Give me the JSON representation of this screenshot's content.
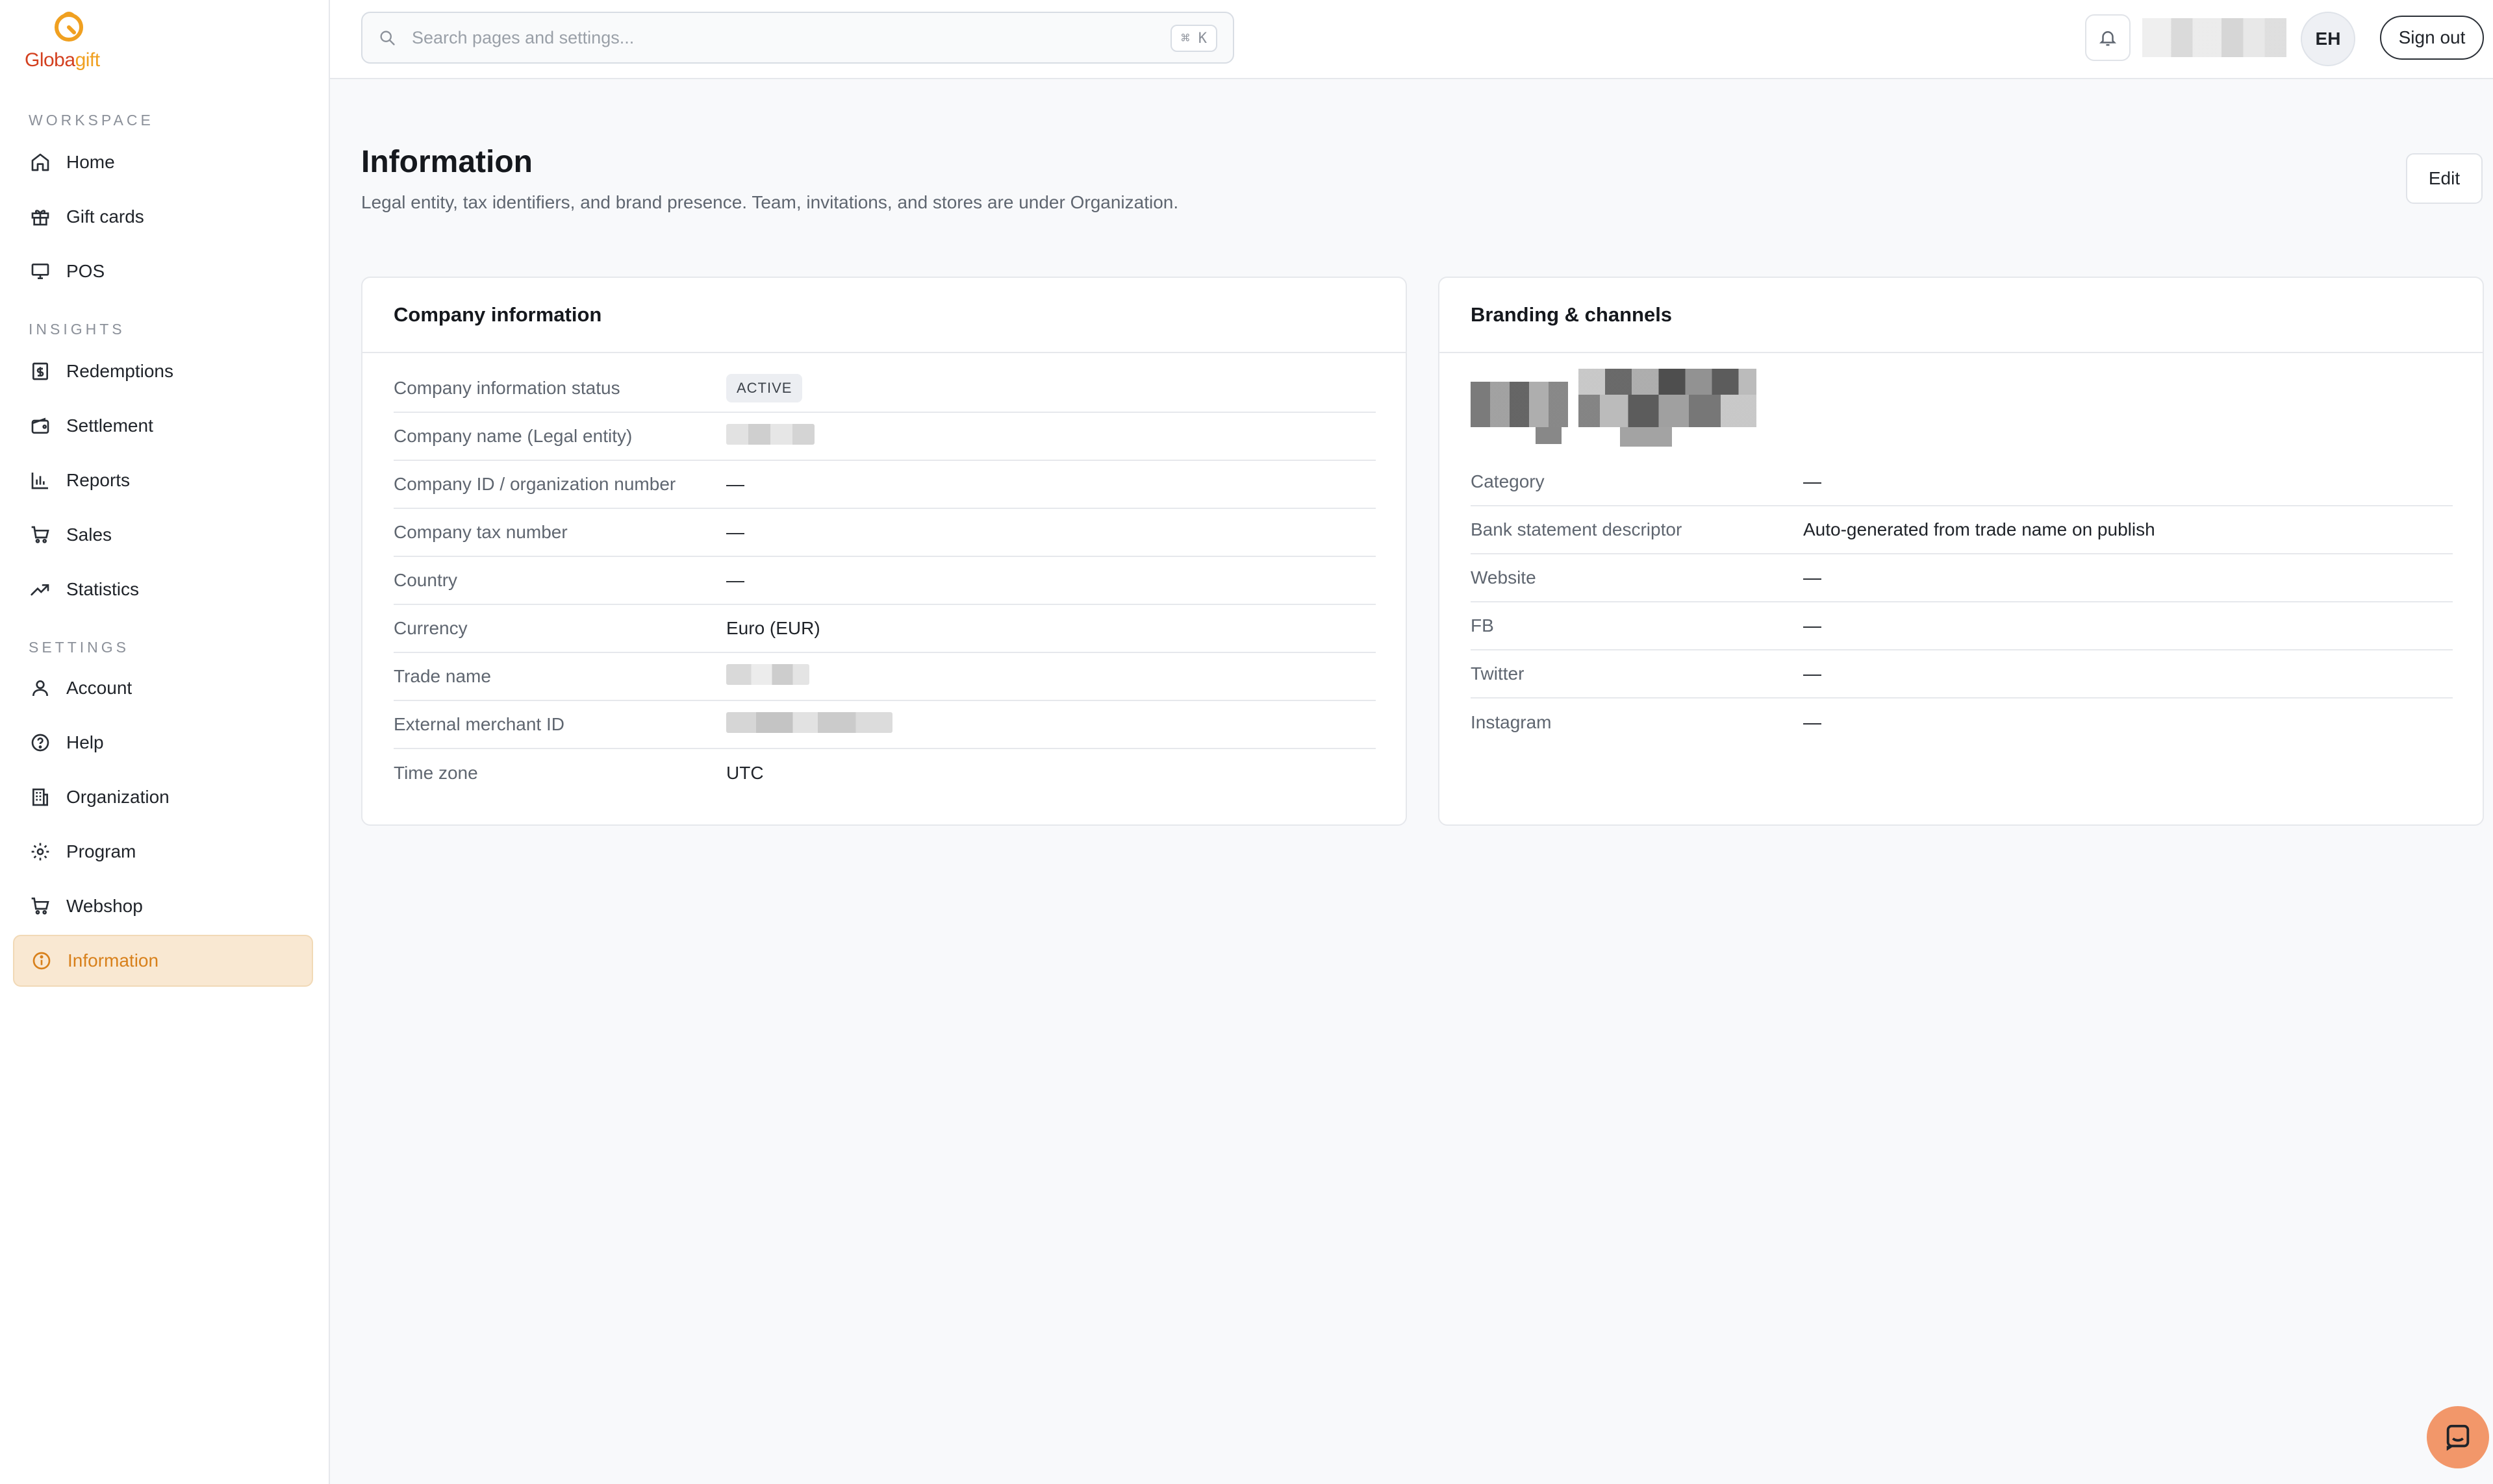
{
  "brand": {
    "name_part1": "Globa",
    "name_part2": "gift"
  },
  "sidebar": {
    "sections": [
      {
        "label": "WORKSPACE"
      },
      {
        "label": "INSIGHTS"
      },
      {
        "label": "SETTINGS"
      }
    ],
    "items": [
      {
        "label": "Home",
        "icon": "home-icon"
      },
      {
        "label": "Gift cards",
        "icon": "gift-icon"
      },
      {
        "label": "POS",
        "icon": "monitor-icon"
      },
      {
        "label": "Redemptions",
        "icon": "receipt-icon"
      },
      {
        "label": "Settlement",
        "icon": "wallet-icon"
      },
      {
        "label": "Reports",
        "icon": "bar-chart-icon"
      },
      {
        "label": "Sales",
        "icon": "cart-icon"
      },
      {
        "label": "Statistics",
        "icon": "trend-icon"
      },
      {
        "label": "Account",
        "icon": "user-icon"
      },
      {
        "label": "Help",
        "icon": "help-icon"
      },
      {
        "label": "Organization",
        "icon": "building-icon"
      },
      {
        "label": "Program",
        "icon": "gear-icon"
      },
      {
        "label": "Webshop",
        "icon": "cart-icon"
      },
      {
        "label": "Information",
        "icon": "info-icon",
        "active": true
      }
    ]
  },
  "topbar": {
    "search_placeholder": "Search pages and settings...",
    "search_shortcut": "⌘ K",
    "avatar_initials": "EH",
    "signout_label": "Sign out"
  },
  "page": {
    "title": "Information",
    "subtitle": "Legal entity, tax identifiers, and brand presence. Team, invitations, and stores are under Organization.",
    "edit_label": "Edit"
  },
  "company_card": {
    "title": "Company information",
    "rows": [
      {
        "label": "Company information status",
        "value": "ACTIVE"
      },
      {
        "label": "Company name (Legal entity)",
        "value": ""
      },
      {
        "label": "Company ID / organization number",
        "value": "—"
      },
      {
        "label": "Company tax number",
        "value": "—"
      },
      {
        "label": "Country",
        "value": "—"
      },
      {
        "label": "Currency",
        "value": "Euro (EUR)"
      },
      {
        "label": "Trade name",
        "value": ""
      },
      {
        "label": "External merchant ID",
        "value": ""
      },
      {
        "label": "Time zone",
        "value": "UTC"
      }
    ]
  },
  "branding_card": {
    "title": "Branding & channels",
    "rows": [
      {
        "label": "Category",
        "value": "—"
      },
      {
        "label": "Bank statement descriptor",
        "value": "Auto-generated from trade name on publish"
      },
      {
        "label": "Website",
        "value": "—"
      },
      {
        "label": "FB",
        "value": "—"
      },
      {
        "label": "Twitter",
        "value": "—"
      },
      {
        "label": "Instagram",
        "value": "—"
      }
    ]
  },
  "colors": {
    "accent": "#f0a020",
    "brand_red": "#d3401f",
    "active_bg": "#f9e8d2",
    "chat": "#f2976a"
  }
}
